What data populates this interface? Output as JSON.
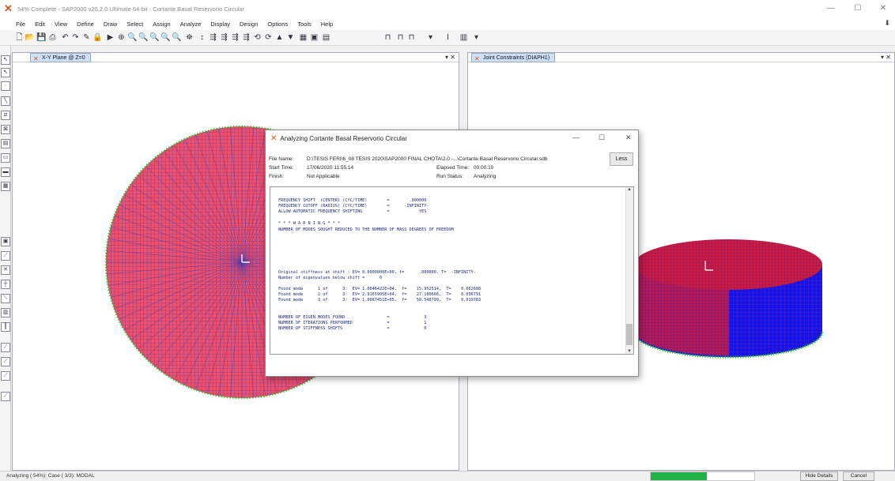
{
  "window": {
    "title": "54% Complete - SAP2000 v20.2.0 Ultimate 64-bit - Cortante Basal Reservorio Circular"
  },
  "menu": [
    "File",
    "Edit",
    "View",
    "Define",
    "Draw",
    "Select",
    "Assign",
    "Analyze",
    "Display",
    "Design",
    "Options",
    "Tools",
    "Help"
  ],
  "panes": {
    "left": {
      "tab": "X-Y Plane @ Z=0"
    },
    "right": {
      "tab": "Joint Constraints (DIAPH1)"
    }
  },
  "dialog": {
    "title": "Analyzing Cortante Basal Reservorio Circular",
    "file_name_label": "File Name:",
    "file_name": "D:\\TESIS FERI\\6_08 TESIS 2020\\SAP2000 FINAL CHOTA\\2.0 -...\\Cortante Basal Reservorio Circular.sdb",
    "start_time_label": "Start Time:",
    "start_time": "17/06/2020 11:55:14",
    "elapsed_label": "Elapsed Time:",
    "elapsed": "00:00:10",
    "finish_label": "Finish:",
    "finish": "Not Applicable",
    "run_status_label": "Run Status:",
    "run_status": "Analyzing",
    "less_button": "Less",
    "log_lines": [
      "FREQUENCY SHIFT  (CENTER) (CYC/TIME)        =        .000000",
      "FREQUENCY CUTOFF (RADIUS) (CYC/TIME)        =      -INFINITY-",
      "ALLOW AUTOMATIC FREQUENCY SHIFTING          =            YES",
      "* * * W A R N I N G * * *",
      "NUMBER OF MODES SOUGHT REDUCED TO THE NUMBER OF MASS DEGREES OF FREEDOM",
      "Original stiffness at shift : EV= 0.0000000E+00, f=      .000000, T=  -INFINITY-",
      "Number of eigenvalues below shift =      0",
      "Found mode      1 of      3:  EV= 1.0046422E+04,  f=    15.952514,  T=    0.062688",
      "Found mode      2 of      3:  EV= 2.9165905E+04,  f=    27.180666,  T=    0.036791",
      "Found mode      3 of      3:  EV= 1.0087451E+05,  f=    50.548799,  T=    0.019783",
      "NUMBER OF EIGEN MODES FOUND                 =              3",
      "NUMBER OF ITERATIONS PERFORMED              =              1",
      "NUMBER OF STIFFNESS SHIFTS                  =              0"
    ]
  },
  "status": {
    "text": "Analyzing ( 54%): Case ( 3/3): MODAL",
    "progress": 0.54,
    "hide_details": "Hide Details",
    "cancel": "Cancel"
  },
  "colors": {
    "mesh_fill": "#ee4f6a",
    "mesh_line": "#4a3aa8",
    "supports": "#16c416",
    "tank_blue": "#1414e8",
    "progress": "#21b146"
  }
}
